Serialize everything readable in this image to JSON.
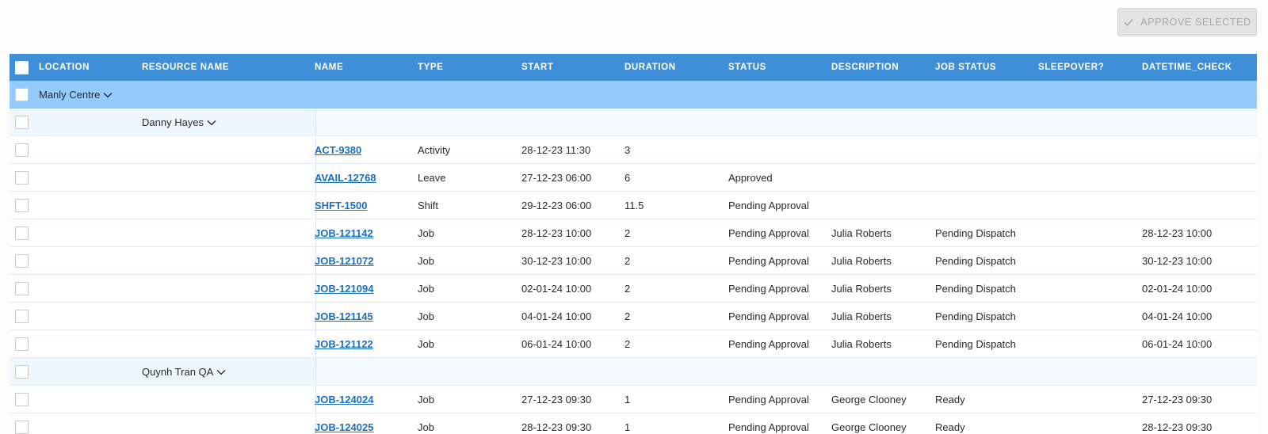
{
  "toolbar": {
    "approve_label": "APPROVE SELECTED"
  },
  "columns": [
    "LOCATION",
    "RESOURCE NAME",
    "NAME",
    "TYPE",
    "START",
    "DURATION",
    "STATUS",
    "DESCRIPTION",
    "JOB STATUS",
    "SLEEPOVER?",
    "DATETIME_CHECK"
  ],
  "groups": {
    "location": "Manly Centre",
    "resource1": "Danny Hayes",
    "resource2": "Quynh Tran QA"
  },
  "rows": [
    {
      "name": "ACT-9380",
      "type": "Activity",
      "start": "28-12-23 11:30",
      "duration": "3",
      "status": "",
      "description": "",
      "job_status": "",
      "sleepover": "",
      "datetime_check": ""
    },
    {
      "name": "AVAIL-12768",
      "type": "Leave",
      "start": "27-12-23 06:00",
      "duration": "6",
      "status": "Approved",
      "description": "",
      "job_status": "",
      "sleepover": "",
      "datetime_check": ""
    },
    {
      "name": "SHFT-1500",
      "type": "Shift",
      "start": "29-12-23 06:00",
      "duration": "11.5",
      "status": "Pending Approval",
      "description": "",
      "job_status": "",
      "sleepover": "",
      "datetime_check": ""
    },
    {
      "name": "JOB-121142",
      "type": "Job",
      "start": "28-12-23 10:00",
      "duration": "2",
      "status": "Pending Approval",
      "description": "Julia Roberts",
      "job_status": "Pending Dispatch",
      "sleepover": "",
      "datetime_check": "28-12-23 10:00"
    },
    {
      "name": "JOB-121072",
      "type": "Job",
      "start": "30-12-23 10:00",
      "duration": "2",
      "status": "Pending Approval",
      "description": "Julia Roberts",
      "job_status": "Pending Dispatch",
      "sleepover": "",
      "datetime_check": "30-12-23 10:00"
    },
    {
      "name": "JOB-121094",
      "type": "Job",
      "start": "02-01-24 10:00",
      "duration": "2",
      "status": "Pending Approval",
      "description": "Julia Roberts",
      "job_status": "Pending Dispatch",
      "sleepover": "",
      "datetime_check": "02-01-24 10:00"
    },
    {
      "name": "JOB-121145",
      "type": "Job",
      "start": "04-01-24 10:00",
      "duration": "2",
      "status": "Pending Approval",
      "description": "Julia Roberts",
      "job_status": "Pending Dispatch",
      "sleepover": "",
      "datetime_check": "04-01-24 10:00"
    },
    {
      "name": "JOB-121122",
      "type": "Job",
      "start": "06-01-24 10:00",
      "duration": "2",
      "status": "Pending Approval",
      "description": "Julia Roberts",
      "job_status": "Pending Dispatch",
      "sleepover": "",
      "datetime_check": "06-01-24 10:00"
    },
    {
      "name": "JOB-124024",
      "type": "Job",
      "start": "27-12-23 09:30",
      "duration": "1",
      "status": "Pending Approval",
      "description": "George Clooney",
      "job_status": "Ready",
      "sleepover": "",
      "datetime_check": "27-12-23 09:30"
    },
    {
      "name": "JOB-124025",
      "type": "Job",
      "start": "28-12-23 09:30",
      "duration": "1",
      "status": "Pending Approval",
      "description": "George Clooney",
      "job_status": "Ready",
      "sleepover": "",
      "datetime_check": "28-12-23 09:30"
    }
  ]
}
